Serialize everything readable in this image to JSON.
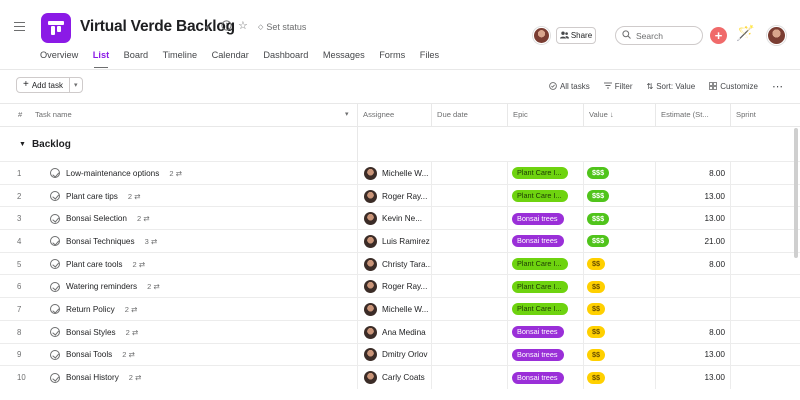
{
  "header": {
    "project_title": "Virtual Verde Backlog",
    "set_status": "Set status",
    "share_label": "Share",
    "search_placeholder": "Search",
    "tabs": [
      "Overview",
      "List",
      "Board",
      "Timeline",
      "Calendar",
      "Dashboard",
      "Messages",
      "Forms",
      "Files"
    ],
    "active_tab": "List",
    "brand_color": "#8b1ae6"
  },
  "toolbar": {
    "add_task": "Add task",
    "all_tasks": "All tasks",
    "filter": "Filter",
    "sort": "Sort: Value",
    "customize": "Customize"
  },
  "columns": {
    "num": "#",
    "task_name": "Task name",
    "assignee": "Assignee",
    "due_date": "Due date",
    "epic": "Epic",
    "value": "Value",
    "estimate": "Estimate (St...",
    "sprint": "Sprint"
  },
  "section": {
    "title": "Backlog"
  },
  "tasks": [
    {
      "num": "1",
      "name": "Low-maintenance options",
      "subtasks": "2",
      "assignee": "Michelle W...",
      "epic": "Plant Care I...",
      "epic_color": "green",
      "value": "$$$",
      "estimate": "8.00"
    },
    {
      "num": "2",
      "name": "Plant care tips",
      "subtasks": "2",
      "assignee": "Roger Ray...",
      "epic": "Plant Care I...",
      "epic_color": "green",
      "value": "$$$",
      "estimate": "13.00"
    },
    {
      "num": "3",
      "name": "Bonsai Selection",
      "subtasks": "2",
      "assignee": "Kevin Ne...",
      "epic": "Bonsai trees",
      "epic_color": "purple",
      "value": "$$$",
      "estimate": "13.00"
    },
    {
      "num": "4",
      "name": "Bonsai Techniques",
      "subtasks": "3",
      "assignee": "Luis Ramirez",
      "epic": "Bonsai trees",
      "epic_color": "purple",
      "value": "$$$",
      "estimate": "21.00"
    },
    {
      "num": "5",
      "name": "Plant care tools",
      "subtasks": "2",
      "assignee": "Christy Tara...",
      "epic": "Plant Care I...",
      "epic_color": "green",
      "value": "$$",
      "estimate": "8.00"
    },
    {
      "num": "6",
      "name": "Watering reminders",
      "subtasks": "2",
      "assignee": "Roger Ray...",
      "epic": "Plant Care I...",
      "epic_color": "green",
      "value": "$$",
      "estimate": ""
    },
    {
      "num": "7",
      "name": "Return Policy",
      "subtasks": "2",
      "assignee": "Michelle W...",
      "epic": "Plant Care I...",
      "epic_color": "green",
      "value": "$$",
      "estimate": ""
    },
    {
      "num": "8",
      "name": "Bonsai Styles",
      "subtasks": "2",
      "assignee": "Ana Medina",
      "epic": "Bonsai trees",
      "epic_color": "purple",
      "value": "$$",
      "estimate": "8.00"
    },
    {
      "num": "9",
      "name": "Bonsai Tools",
      "subtasks": "2",
      "assignee": "Dmitry Orlov",
      "epic": "Bonsai trees",
      "epic_color": "purple",
      "value": "$$",
      "estimate": "13.00"
    },
    {
      "num": "10",
      "name": "Bonsai History",
      "subtasks": "2",
      "assignee": "Carly Coats",
      "epic": "Bonsai trees",
      "epic_color": "purple",
      "value": "$$",
      "estimate": "13.00"
    }
  ]
}
